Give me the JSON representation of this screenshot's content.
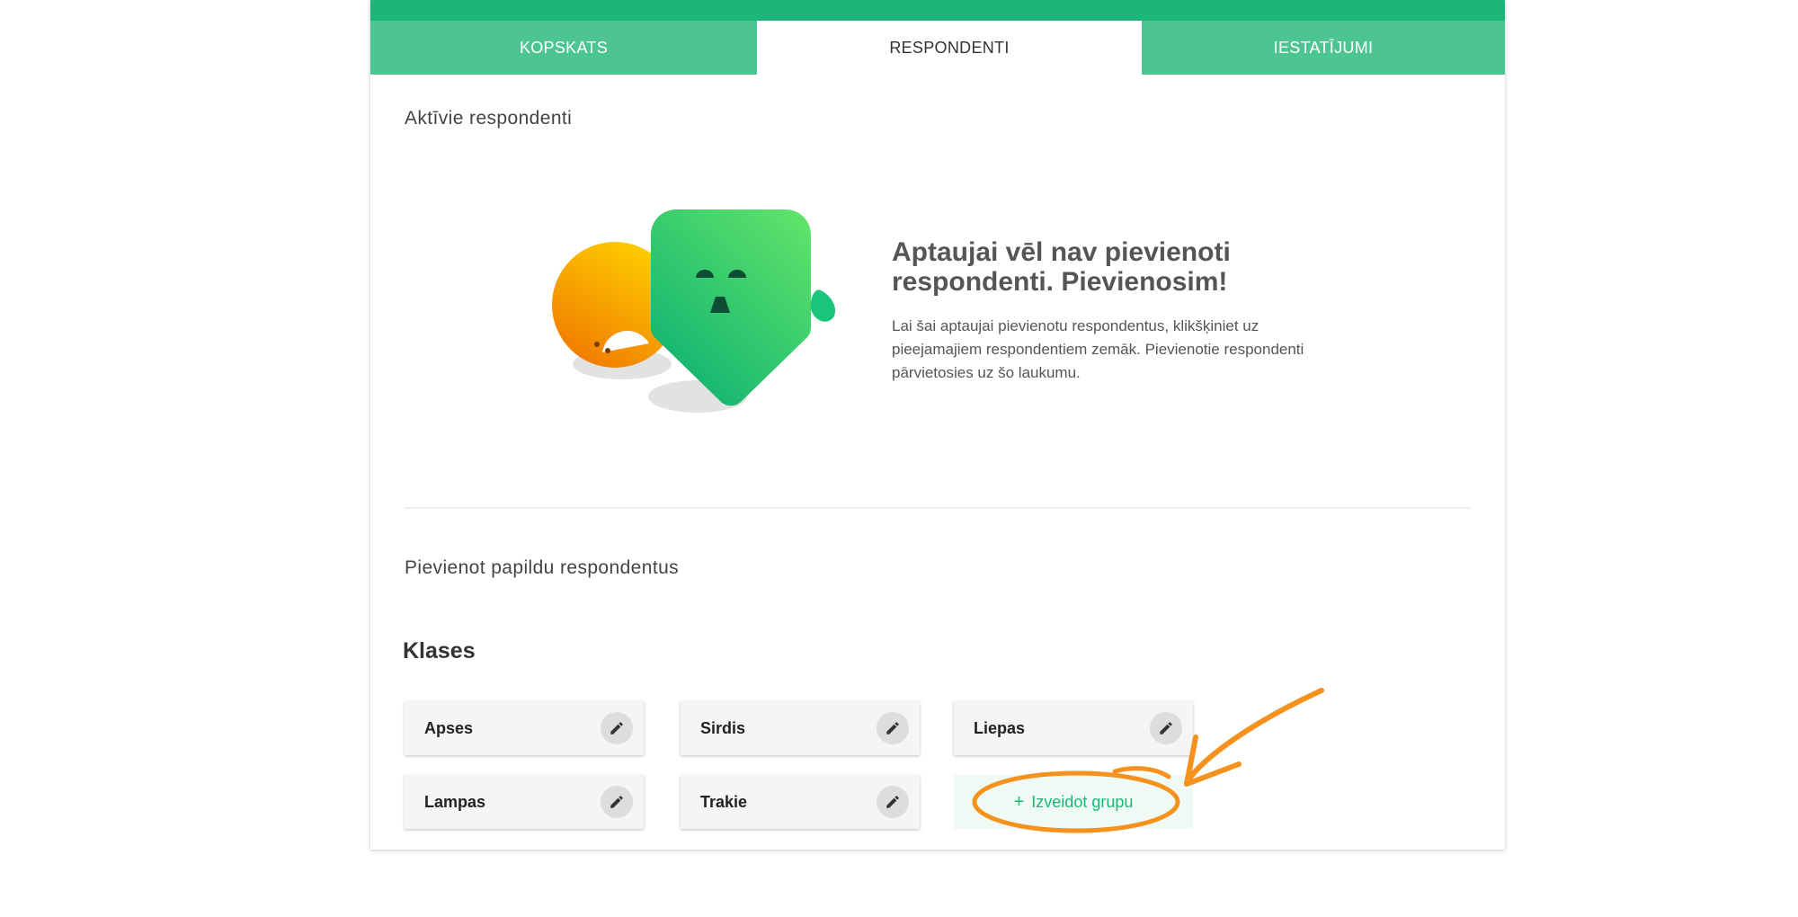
{
  "tabs": [
    {
      "label": "KOPSKATS"
    },
    {
      "label": "RESPONDENTI"
    },
    {
      "label": "IESTATĪJUMI"
    }
  ],
  "active_section": {
    "title": "Aktīvie respondenti"
  },
  "empty_state": {
    "title": "Aptaujai vēl nav pievienoti respondenti. Pievienosim!",
    "description": "Lai šai aptaujai pievienotu respondentus, klikšķiniet uz pieejamajiem respondentiem zemāk. Pievienotie respondenti pārvietosies uz šo laukumu."
  },
  "add_section": {
    "title": "Pievienot papildu respondentus"
  },
  "classes": {
    "heading": "Klases",
    "groups": [
      {
        "name": "Apses"
      },
      {
        "name": "Sirdis"
      },
      {
        "name": "Liepas"
      },
      {
        "name": "Lampas"
      },
      {
        "name": "Trakie"
      }
    ],
    "create_label": "Izveidot grupu"
  },
  "colors": {
    "accent": "#1db67a",
    "tab_bg": "#4dc593",
    "annotation": "#f5921e"
  }
}
